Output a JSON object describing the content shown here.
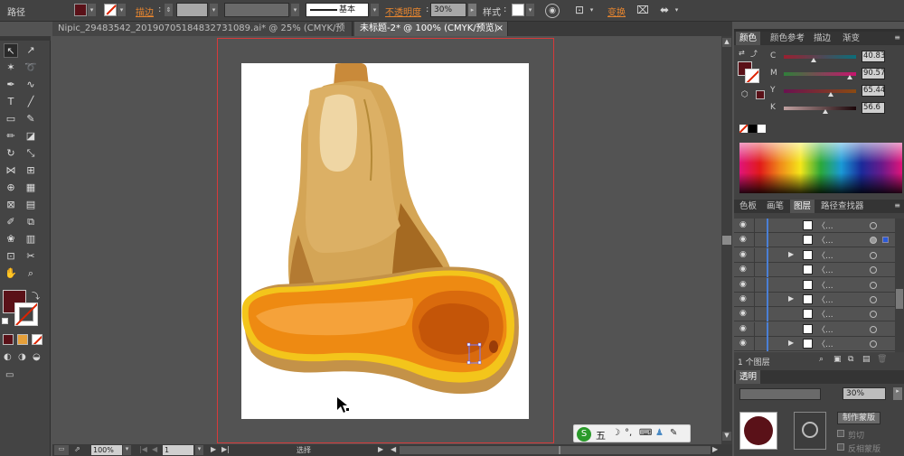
{
  "control_bar": {
    "object_label": "路径",
    "stroke_label": "描边",
    "stroke_style": "基本",
    "opacity_label": "不透明度",
    "opacity_value": "30%",
    "style_label": "样式",
    "transform_label": "变换",
    "fill_color": "#5a1118"
  },
  "tabs": [
    {
      "label": "Nipic_29483542_20190705184832731089.ai* @ 25% (CMYK/预览)",
      "close": "×"
    },
    {
      "label": "未标题-2* @ 100% (CMYK/预览)",
      "close": "×"
    }
  ],
  "tools": {
    "fill_color": "#5a1118",
    "icons": [
      "selection-icon",
      "direct-selection-icon",
      "magic-wand-icon",
      "lasso-icon",
      "pen-icon",
      "curvature-icon",
      "type-icon",
      "line-icon",
      "rectangle-icon",
      "paintbrush-icon",
      "pencil-icon",
      "eraser-icon",
      "rotate-icon",
      "scale-icon",
      "width-icon",
      "free-transform-icon",
      "shape-builder-icon",
      "perspective-icon",
      "mesh-icon",
      "gradient-icon",
      "eyedropper-icon",
      "blend-icon",
      "symbol-sprayer-icon",
      "column-graph-icon",
      "artboard-icon",
      "slice-icon",
      "hand-icon",
      "zoom-icon"
    ]
  },
  "color_panel": {
    "tabs": [
      "颜色",
      "颜色参考",
      "描边",
      "渐变"
    ],
    "channels": [
      {
        "name": "C",
        "value": "40.83",
        "color_from": "#9a2030",
        "color_to": "#0a6e7a",
        "level": 0.41
      },
      {
        "name": "M",
        "value": "90.57",
        "color_from": "#2f7e3a",
        "color_to": "#c8146e",
        "level": 0.91
      },
      {
        "name": "Y",
        "value": "65.44",
        "color_from": "#6a1250",
        "color_to": "#8a4a12",
        "level": 0.65
      },
      {
        "name": "K",
        "value": "56.6",
        "color_from": "#c0a0a0",
        "color_to": "#1a0508",
        "level": 0.57
      }
    ],
    "fill_color": "#5a1118"
  },
  "layers_panel": {
    "tabs": [
      "色板",
      "画笔",
      "图层",
      "路径查找器"
    ],
    "rows": [
      {
        "name": "〈...",
        "expand": ""
      },
      {
        "name": "〈...",
        "expand": ""
      },
      {
        "name": "〈...",
        "expand": "▶"
      },
      {
        "name": "〈...",
        "expand": ""
      },
      {
        "name": "〈...",
        "expand": ""
      },
      {
        "name": "〈...",
        "expand": "▶"
      },
      {
        "name": "〈...",
        "expand": ""
      },
      {
        "name": "〈...",
        "expand": ""
      },
      {
        "name": "〈...",
        "expand": "▶"
      }
    ],
    "footer": "1 个图层"
  },
  "transparency_panel": {
    "title": "透明",
    "opacity_value": "30%",
    "make_mask_label": "制作蒙版",
    "clip_label": "剪切",
    "invert_mask_label": "反相蒙版"
  },
  "status_bar": {
    "zoom": "100%",
    "page": "1",
    "tool": "选择"
  },
  "ime": {
    "label": "五"
  }
}
